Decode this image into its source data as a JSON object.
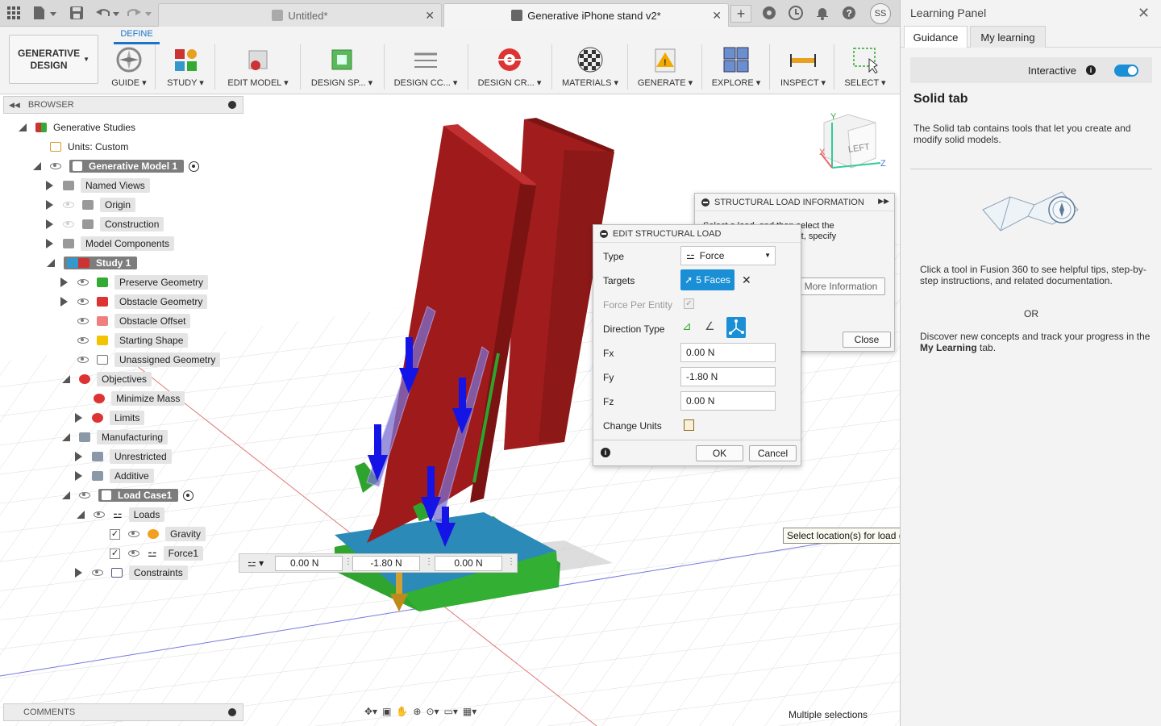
{
  "window": {
    "tabs": [
      {
        "title": "Untitled*"
      },
      {
        "title": "Generative iPhone stand v2*"
      }
    ],
    "user_initials": "SS"
  },
  "toolbar": {
    "workspace_line1": "GENERATIVE",
    "workspace_line2": "DESIGN",
    "active_tab": "DEFINE",
    "tools": [
      "GUIDE",
      "STUDY",
      "EDIT MODEL",
      "DESIGN SP...",
      "DESIGN CC...",
      "DESIGN CR...",
      "MATERIALS",
      "GENERATE",
      "EXPLORE",
      "INSPECT",
      "SELECT"
    ]
  },
  "browser": {
    "title": "BROWSER",
    "items": {
      "root": "Generative Studies",
      "units": "Units: Custom",
      "model": "Generative Model 1",
      "named_views": "Named Views",
      "origin": "Origin",
      "construction": "Construction",
      "model_components": "Model Components",
      "study": "Study 1",
      "preserve": "Preserve Geometry",
      "obstacle": "Obstacle Geometry",
      "obstacle_offset": "Obstacle Offset",
      "starting_shape": "Starting Shape",
      "unassigned": "Unassigned Geometry",
      "objectives": "Objectives",
      "minimize_mass": "Minimize Mass",
      "limits": "Limits",
      "manufacturing": "Manufacturing",
      "unrestricted": "Unrestricted",
      "additive": "Additive",
      "load_case": "Load Case1",
      "loads": "Loads",
      "gravity": "Gravity",
      "force1": "Force1",
      "constraints": "Constraints"
    }
  },
  "info_dialog": {
    "title": "STRUCTURAL LOAD INFORMATION",
    "text_line1": "Select a load, and then select the",
    "text_line2": "location for the load. Next, specify",
    "text_line3": "magnitude and direction.",
    "more_info_label": "More Information",
    "close_label": "Close"
  },
  "edit_dialog": {
    "title": "EDIT STRUCTURAL LOAD",
    "type_label": "Type",
    "type_value": "Force",
    "targets_label": "Targets",
    "targets_value": "5 Faces",
    "force_per_entity_label": "Force Per Entity",
    "direction_label": "Direction Type",
    "fx_label": "Fx",
    "fx_value": "0.00 N",
    "fy_label": "Fy",
    "fy_value": "-1.80 N",
    "fz_label": "Fz",
    "fz_value": "0.00 N",
    "units_label": "Change Units",
    "ok_label": "OK",
    "cancel_label": "Cancel"
  },
  "float_inputs": {
    "fx": "0.00 N",
    "fy": "-1.80 N",
    "fz": "0.00 N"
  },
  "viewcube_label": "LEFT",
  "tooltip": "Select location(s) for load (only faces).",
  "comments_label": "COMMENTS",
  "status_text": "Multiple selections",
  "learning_panel": {
    "title": "Learning Panel",
    "tabs": [
      "Guidance",
      "My learning"
    ],
    "interactive_label": "Interactive",
    "interactive_on": true,
    "heading": "Solid tab",
    "desc": "The Solid tab contains tools that let you create and modify solid models.",
    "tip": "Click a tool in Fusion 360 to see helpful tips, step-by-step instructions, and related documentation.",
    "or": "OR",
    "discover_prefix": "Discover new concepts and track your progress in the ",
    "discover_bold": "My Learning",
    "discover_suffix": " tab."
  },
  "colors": {
    "accent": "#1a8fd6",
    "model_red": "#9b1c1c",
    "preserve_green": "#2ea42e",
    "base_blue": "#2e87b8",
    "load_arrow": "#1414e6"
  }
}
